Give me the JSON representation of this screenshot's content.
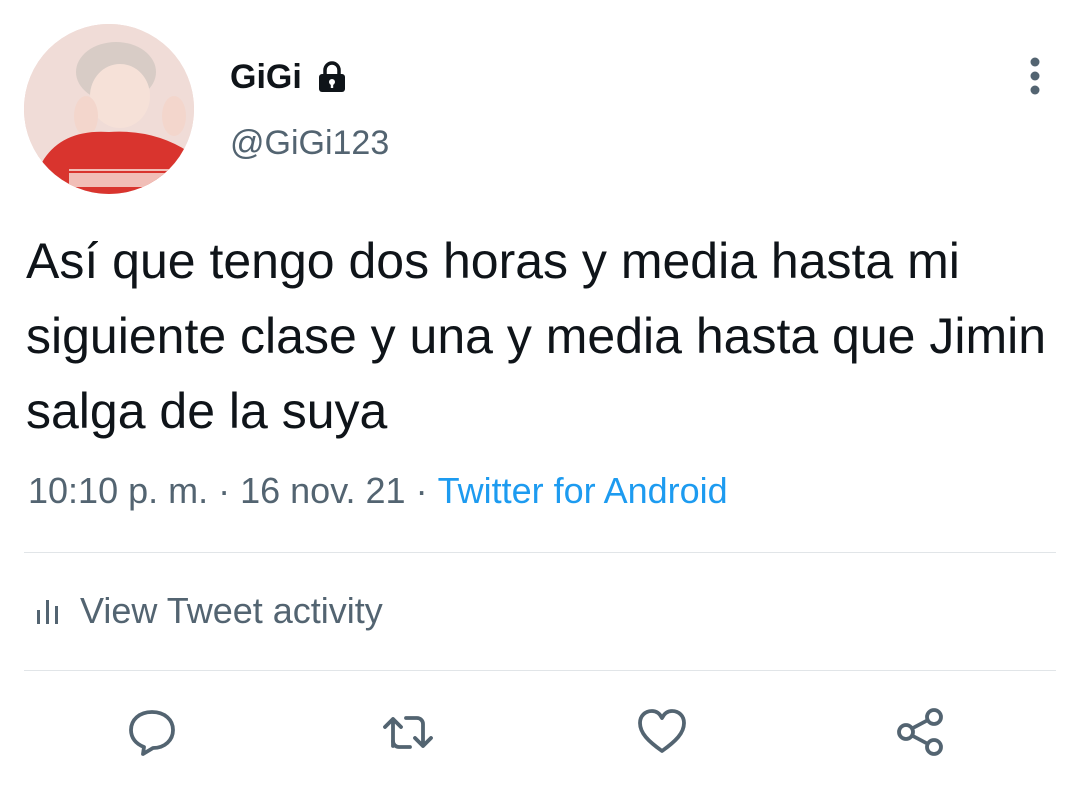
{
  "user": {
    "display_name": "GiGi",
    "handle": "@GiGi123"
  },
  "tweet": {
    "text": "Así que tengo dos horas y media hasta mi siguiente clase y una y media hasta que Jimin salga de la suya",
    "time": "10:10 p. m.",
    "date": "16 nov. 21",
    "source": "Twitter for Android",
    "separator": "·"
  },
  "activity": {
    "label": "View Tweet activity"
  },
  "icons": {
    "lock": "lock-icon",
    "more": "vertical-ellipsis-icon",
    "activity": "bar-chart-icon",
    "reply": "comment-bubble-icon",
    "retweet": "retweet-icon",
    "like": "heart-icon",
    "share": "share-icon"
  },
  "colors": {
    "text_primary": "#0f1419",
    "text_secondary": "#536471",
    "link": "#1d9bf0",
    "divider": "#e1e5e8",
    "icon": "#536471"
  }
}
